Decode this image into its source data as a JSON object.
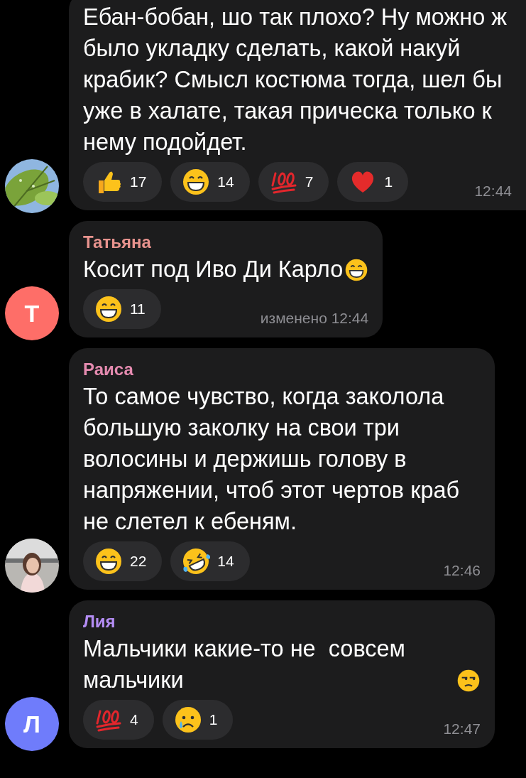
{
  "messages": [
    {
      "text": "Ебан-бобан, шо так плохо? Ну можно ж было укладку сделать, какой накуй крабик? Смысл костюма тогда, шел бы уже в халате, такая прическа только к нему подойдет.",
      "reactions": [
        {
          "kind": "thumbsup",
          "count": "17"
        },
        {
          "kind": "grin",
          "count": "14"
        },
        {
          "kind": "hundred",
          "count": "7"
        },
        {
          "kind": "heart",
          "count": "1"
        }
      ],
      "time": "12:44"
    },
    {
      "avatar": {
        "kind": "letter",
        "letter": "Т",
        "color": "#fe6e68"
      },
      "sender": {
        "name": "Татьяна",
        "color": "#e8938e"
      },
      "text": "Косит под Иво Ди Карло",
      "text_emoji": {
        "kind": "grin"
      },
      "reactions": [
        {
          "kind": "grin",
          "count": "11"
        }
      ],
      "time": "изменено 12:44"
    },
    {
      "sender": {
        "name": "Раиса",
        "color": "#e58bb0"
      },
      "text": "То самое чувство, когда заколола большую заколку на свои три волосины и держишь голову в напряжении, чтоб этот чертов краб не слетел к ебеням.",
      "reactions": [
        {
          "kind": "grin",
          "count": "22"
        },
        {
          "kind": "rofl",
          "count": "14"
        }
      ],
      "time": "12:46"
    },
    {
      "avatar": {
        "kind": "letter",
        "letter": "Л",
        "color": "#6f7cfb"
      },
      "sender": {
        "name": "Лия",
        "color": "#b48df4"
      },
      "text": "Мальчики какие-то не  совсем мальчики",
      "text_emoji": {
        "kind": "unamused"
      },
      "reactions": [
        {
          "kind": "hundred",
          "count": "4"
        },
        {
          "kind": "cry",
          "count": "1"
        }
      ],
      "time": "12:47"
    }
  ]
}
